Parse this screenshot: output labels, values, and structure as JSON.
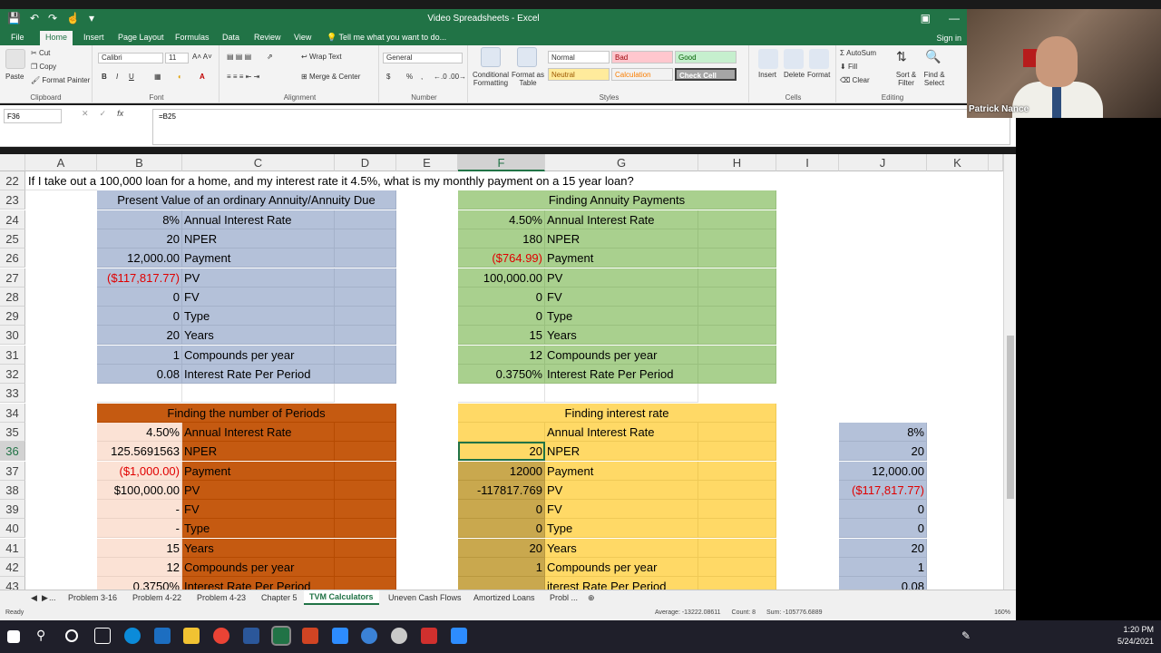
{
  "window": {
    "title": "Video Spreadsheets - Excel"
  },
  "ribbon_tabs": [
    "File",
    "Home",
    "Insert",
    "Page Layout",
    "Formulas",
    "Data",
    "Review",
    "View"
  ],
  "tell_me": "Tell me what you want to do...",
  "signin": "Sign in",
  "clipboard": {
    "paste": "Paste",
    "cut": "Cut",
    "copy": "Copy",
    "format_painter": "Format Painter",
    "group": "Clipboard"
  },
  "font": {
    "name": "Calibri",
    "size": "11",
    "group": "Font",
    "bold": "B",
    "italic": "I",
    "underline": "U"
  },
  "alignment": {
    "wrap": "Wrap Text",
    "merge": "Merge & Center",
    "group": "Alignment"
  },
  "number": {
    "format": "General",
    "group": "Number",
    "currency": "$",
    "percent": "%",
    "comma": ","
  },
  "styles": {
    "conditional": "Conditional Formatting",
    "format_table": "Format as Table",
    "normal": "Normal",
    "bad": "Bad",
    "good": "Good",
    "neutral": "Neutral",
    "calculation": "Calculation",
    "check_cell": "Check Cell",
    "group": "Styles"
  },
  "cells_grp": {
    "insert": "Insert",
    "delete": "Delete",
    "format": "Format",
    "group": "Cells"
  },
  "editing": {
    "autosum": "AutoSum",
    "fill": "Fill",
    "clear": "Clear",
    "sort": "Sort & Filter",
    "find": "Find & Select",
    "group": "Editing"
  },
  "formula_bar": {
    "name_box": "F36",
    "formula": "=B25"
  },
  "columns": [
    "A",
    "B",
    "C",
    "D",
    "E",
    "F",
    "G",
    "H",
    "I",
    "J",
    "K"
  ],
  "rows": [
    "22",
    "23",
    "24",
    "25",
    "26",
    "27",
    "28",
    "29",
    "30",
    "31",
    "32",
    "33",
    "34",
    "35",
    "36",
    "37",
    "38",
    "39",
    "40",
    "41",
    "42",
    "43"
  ],
  "question": "If I take out a 100,000 loan for a home, and my interest rate it 4.5%, what is my monthly payment on a 15 year loan?",
  "pv_table": {
    "title": "Present Value of an ordinary Annuity/Annuity Due",
    "values": [
      "8%",
      "20",
      "12,000.00",
      "($117,817.77)",
      "0",
      "0",
      "20",
      "1",
      "0.08"
    ],
    "labels": [
      "Annual Interest Rate",
      "NPER",
      "Payment",
      "PV",
      "FV",
      "Type",
      "Years",
      "Compounds per year",
      "Interest Rate Per Period"
    ]
  },
  "annuity_table": {
    "title": "Finding Annuity Payments",
    "values": [
      "4.50%",
      "180",
      "($764.99)",
      "100,000.00",
      "0",
      "0",
      "15",
      "12",
      "0.3750%"
    ],
    "labels": [
      "Annual Interest Rate",
      "NPER",
      "Payment",
      "PV",
      "FV",
      "Type",
      "Years",
      "Compounds per year",
      "Interest Rate Per Period"
    ]
  },
  "periods_table": {
    "title": "Finding the number of Periods",
    "values": [
      "4.50%",
      "125.5691563",
      "($1,000.00)",
      "$100,000.00",
      "-",
      "-",
      "15",
      "12",
      "0.3750%"
    ],
    "labels": [
      "Annual Interest Rate",
      "NPER",
      "Payment",
      "PV",
      "FV",
      "Type",
      "Years",
      "Compounds per year",
      "Interest Rate Per Period"
    ]
  },
  "rate_table": {
    "title": "Finding interest rate",
    "values": [
      "",
      "20",
      "12000",
      "-117817.769",
      "0",
      "0",
      "20",
      "1"
    ],
    "labels": [
      "Annual Interest Rate",
      "NPER",
      "Payment",
      "PV",
      "FV",
      "Type",
      "Years",
      "Compounds per year",
      "iterest Rate Per Period"
    ]
  },
  "j_column": [
    "8%",
    "20",
    "12,000.00",
    "($117,817.77)",
    "0",
    "0",
    "20",
    "1",
    "0.08"
  ],
  "sheet_tabs": [
    "...",
    "Problem 3-16",
    "Problem 4-22",
    "Problem 4-23",
    "Chapter 5",
    "TVM Calculators",
    "Uneven Cash Flows",
    "Amortized Loans",
    "Probl ..."
  ],
  "status": {
    "ready": "Ready",
    "average": "Average: -13222.08611",
    "count": "Count: 8",
    "sum": "Sum: -105776.6889",
    "zoom": "160%"
  },
  "webcam": {
    "name": "Patrick Nance"
  },
  "clock": {
    "time": "1:20 PM",
    "date": "5/24/2021"
  },
  "colors": {
    "excel_green": "#217346",
    "blue_fill": "#b4c1d9",
    "green_fill": "#a9d08e",
    "orange_fill": "#c55a11",
    "yellow_fill": "#ffd966",
    "negative": "#e00000"
  }
}
